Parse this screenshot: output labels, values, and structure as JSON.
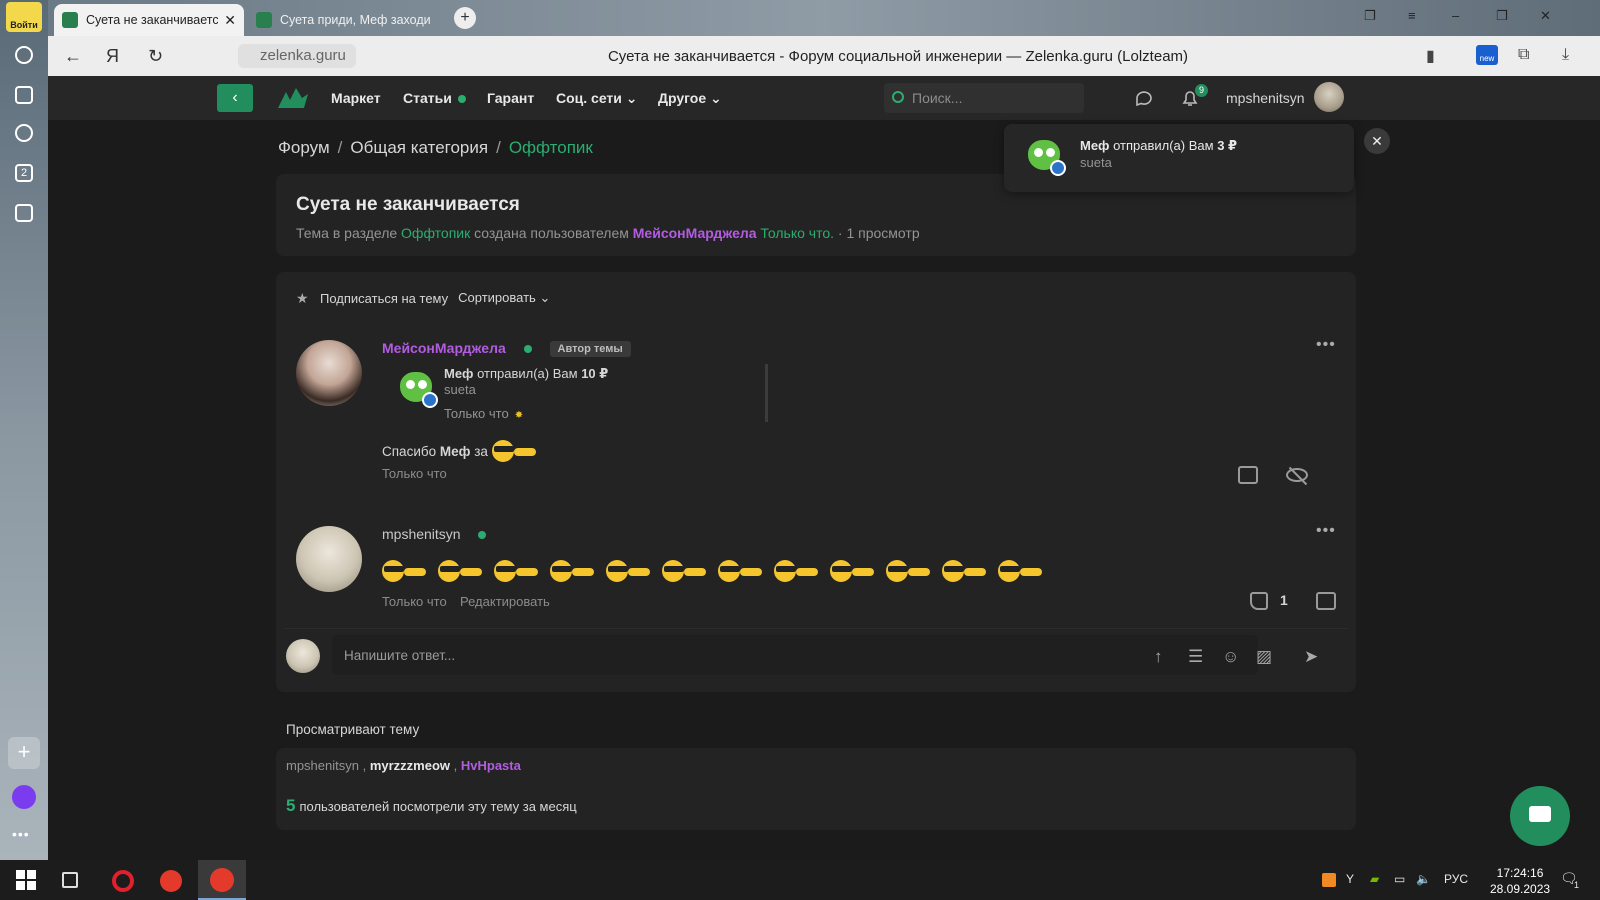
{
  "browser": {
    "sidebar": {
      "login_label": "Войти",
      "workspace_number": "2"
    },
    "tabs": [
      {
        "title": "Суета не заканчивается",
        "active": true
      },
      {
        "title": "Суета приди, Меф заходи",
        "active": false
      }
    ],
    "address": {
      "url": "zelenka.guru",
      "page_title": "Суета не заканчивается - Форум социальной инженерии — Zelenka.guru (Lolzteam)",
      "new_badge": "new"
    }
  },
  "site_header": {
    "nav": [
      {
        "label": "Маркет"
      },
      {
        "label": "Статьи",
        "dot": true
      },
      {
        "label": "Гарант"
      },
      {
        "label": "Соц. сети",
        "dropdown": true
      },
      {
        "label": "Другое",
        "dropdown": true
      }
    ],
    "search_placeholder": "Поиск...",
    "notifications_count": "9",
    "username": "mpshenitsyn"
  },
  "breadcrumb": {
    "items": [
      "Форум",
      "Общая категория"
    ],
    "current": "Оффтопик"
  },
  "thread": {
    "title": "Суета не заканчивается",
    "meta_prefix": "Тема в разделе",
    "meta_section": "Оффтопик",
    "meta_created_by": "создана пользователем",
    "meta_author": "МейсонМарджела",
    "meta_time": "Только что.",
    "meta_views": "1 просмотр"
  },
  "toolbar": {
    "subscribe_label": "Подписаться на тему",
    "sort_label": "Сортировать"
  },
  "posts": [
    {
      "author": "МейсонМарджела",
      "badge": "Автор темы",
      "quote": {
        "sender": "Меф",
        "action": "отправил(а) Вам",
        "amount": "10 ₽",
        "comment": "sueta",
        "time": "Только что"
      },
      "text_before": "Спасибо",
      "text_name": "Меф",
      "text_after": "за",
      "emoji_count": 1,
      "date": "Только что"
    },
    {
      "author": "mpshenitsyn",
      "emoji_count": 12,
      "date": "Только что",
      "edit_label": "Редактировать",
      "likes": "1"
    }
  ],
  "reply": {
    "placeholder": "Напишите ответ..."
  },
  "viewers": {
    "label": "Просматривают тему",
    "list": [
      "mpshenitsyn",
      "myrzzzmeow",
      "HvHpasta"
    ],
    "month_count": "5",
    "month_text": "пользователей посмотрели эту тему за месяц"
  },
  "toast": {
    "sender": "Меф",
    "action": "отправил(а) Вам",
    "amount": "3 ₽",
    "comment": "sueta"
  },
  "taskbar": {
    "lang": "РУС",
    "time": "17:24:16",
    "date": "28.09.2023",
    "notif_count": "1"
  },
  "colors": {
    "accent_green": "#2bad72",
    "author_purple": "#b35ce2",
    "bg": "#1b1b1b",
    "card": "#232323"
  }
}
